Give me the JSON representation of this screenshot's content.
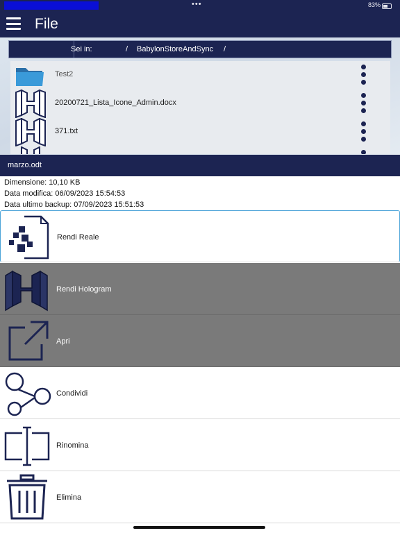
{
  "status_bar": {
    "dots": "•••",
    "battery_text": "83%"
  },
  "app": {
    "title": "File"
  },
  "breadcrumb": {
    "label": "Sei in:",
    "sep1": "/",
    "folder": "BabylonStoreAndSync",
    "sep2": "/"
  },
  "files": [
    {
      "name": "Test2",
      "icon": "folder-icon"
    },
    {
      "name": "20200721_Lista_Icone_Admin.docx",
      "icon": "hologram-file-icon"
    },
    {
      "name": "371.txt",
      "icon": "hologram-file-icon"
    }
  ],
  "sheet": {
    "title": "marzo.odt",
    "size": "Dimensione: 10,10 KB",
    "modified": "Data modifica: 06/09/2023 15:54:53",
    "backup": "Data ultimo backup: 07/09/2023 15:51:53"
  },
  "actions": [
    {
      "label": "Rendi Reale",
      "icon": "make-real-icon"
    },
    {
      "label": "Rendi Hologram",
      "icon": "hologram-icon"
    },
    {
      "label": "Apri",
      "icon": "open-external-icon"
    },
    {
      "label": "Condividi",
      "icon": "share-icon"
    },
    {
      "label": "Rinomina",
      "icon": "rename-icon"
    },
    {
      "label": "Elimina",
      "icon": "trash-icon"
    }
  ],
  "colors": {
    "primary": "#1c2452",
    "disabled_row": "#7a7a7a",
    "accent_border": "#4aa3d8",
    "folder": "#3a9ad9"
  }
}
